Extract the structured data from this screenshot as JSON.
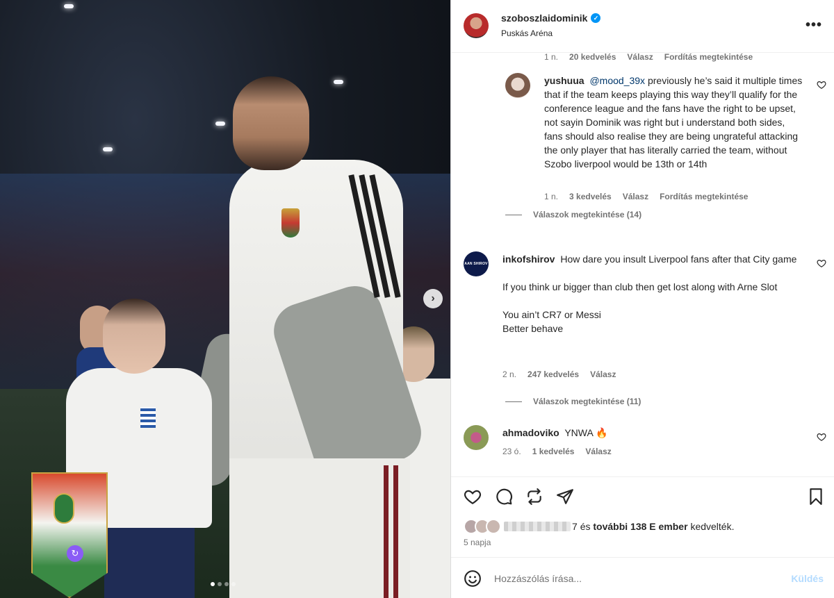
{
  "post": {
    "username": "szoboszlaidominik",
    "location": "Puskás Aréna",
    "verified_mark": "✓",
    "more_label": "•••"
  },
  "photo": {
    "next_label": "›",
    "dots_count": 4,
    "collab_icon": "↻"
  },
  "comments": {
    "prev_reply_meta": {
      "time": "1 n.",
      "likes": "20 kedvelés",
      "reply": "Válasz",
      "translate": "Fordítás megtekintése"
    },
    "reply1": {
      "username": "yushuua",
      "mention": "@mood_39x",
      "text": "previously he’s said it multiple times that if the team keeps playing this way they’ll qualify for the conference league and the fans have the right to be upset, not sayin Dominik was right but i understand both sides, fans should also realise they are being ungrateful attacking the only player that has literally carried the team, without Szobo liverpool would be 13th or 14th",
      "time": "1 n.",
      "likes": "3 kedvelés",
      "reply": "Válasz",
      "translate": "Fordítás megtekintése"
    },
    "view_replies_1": "Válaszok megtekintése (14)",
    "c2": {
      "username": "inkofshirov",
      "avatar_text": "AAN SHIROV",
      "line1": "How dare you insult Liverpool fans after that City game",
      "line2": "If you think ur bigger than club then get lost along with Arne Slot",
      "line3": "You ain’t CR7 or Messi",
      "line4": "Better behave",
      "time": "2 n.",
      "likes": "247 kedvelés",
      "reply": "Válasz"
    },
    "view_replies_2": "Válaszok megtekintése (11)",
    "c3": {
      "username": "ahmadoviko",
      "text": "YNWA",
      "emoji": "🔥",
      "time": "23 ó.",
      "likes": "1 kedvelés",
      "reply": "Válasz"
    }
  },
  "actions": {
    "icons": [
      "heart-icon",
      "comment-icon",
      "repost-icon",
      "share-icon",
      "bookmark-icon"
    ],
    "likes_suffix": "7",
    "likes_and": "és",
    "likes_others": "további 138 E ember",
    "likes_tail": "kedvelték.",
    "date": "5 napja"
  },
  "add_comment": {
    "placeholder": "Hozzászólás írása...",
    "post_label": "Küldés"
  },
  "colors": {
    "link": "#00376b",
    "verified": "#0095f6",
    "post_button_disabled": "#b3dbff",
    "meta_gray": "#737373"
  }
}
